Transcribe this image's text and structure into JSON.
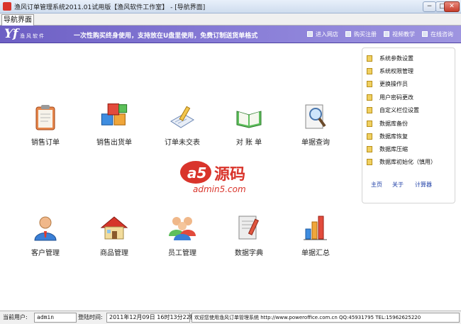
{
  "window": {
    "title": "渔风订单管理系统2011.01试用版【渔风软件工作室】 - [导航界面]",
    "min_glyph": "−",
    "max_glyph": "□",
    "close_glyph": "✕"
  },
  "tab": {
    "label": "导航界面"
  },
  "banner": {
    "logo": "Ƴf",
    "logo_text": "渔风软件",
    "slogan": "一次性购买终身使用，支持放在U盘里使用，免费订制送货单格式",
    "links": [
      "进入网店",
      "购买注册",
      "视频教学",
      "在线咨询"
    ]
  },
  "tiles_row1": [
    "销售订单",
    "销售出货单",
    "订单未交表",
    "对 账 单",
    "单据查询"
  ],
  "tiles_row2": [
    "客户管理",
    "商品管理",
    "员工管理",
    "数据字典",
    "单据汇总"
  ],
  "panel": {
    "items": [
      "系统参数设置",
      "系统权限管理",
      "更换操作员",
      "用户密码更改",
      "自定义栏位设置",
      "数据库备份",
      "数据库恢复",
      "数据库压缩",
      "数据库初始化（慎用）"
    ],
    "links": [
      "主页",
      "关于",
      "计算器"
    ]
  },
  "watermark": {
    "a5": "a5",
    "yuanma": "源码",
    "site": "admin5.com"
  },
  "status": {
    "user_label": "当前用户:",
    "user_value": "admin",
    "login_label": "登陆时间:",
    "login_value": "2011年12月09日 16时13分22秒",
    "welcome": "欢迎您使用渔风订单管理系统 http://www.poweroffice.com.cn QQ:45931795 TEL:15962625220"
  },
  "colors": {
    "banner": "#7a6ecf",
    "accent_red": "#d9342b",
    "link_blue": "#1d3ea6"
  }
}
